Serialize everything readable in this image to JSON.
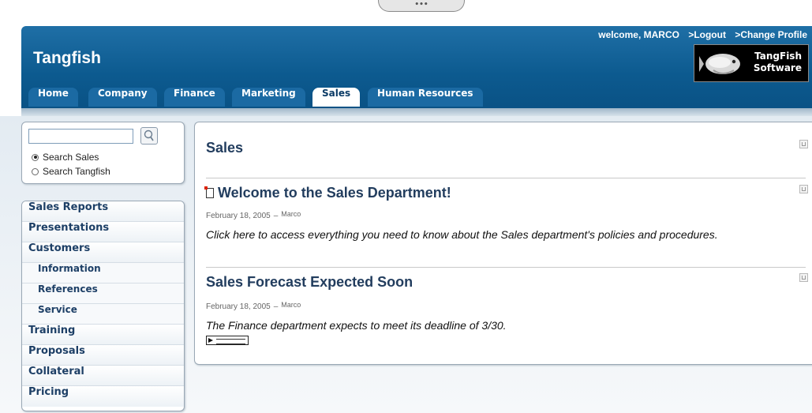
{
  "top_handle": "•••",
  "header": {
    "welcome": "welcome, MARCO",
    "logout": ">Logout",
    "change_profile": ">Change Profile",
    "site_title": "Tangfish",
    "logo_line1": "TangFish",
    "logo_line2": "Software",
    "bg_color": "#0c5a8f"
  },
  "tabs": [
    {
      "label": "Home"
    },
    {
      "label": "Company"
    },
    {
      "label": "Finance"
    },
    {
      "label": "Marketing"
    },
    {
      "label": "Sales",
      "active": true
    },
    {
      "label": "Human Resources"
    }
  ],
  "search": {
    "value": "",
    "option_sales": "Search Sales",
    "option_tangfish": "Search Tangfish",
    "selected": "Search Sales"
  },
  "sidenav": [
    {
      "label": "Sales Reports"
    },
    {
      "label": "Presentations"
    },
    {
      "label": "Customers"
    },
    {
      "label": "Information",
      "sub": true
    },
    {
      "label": "References",
      "sub": true
    },
    {
      "label": "Service",
      "sub": true
    },
    {
      "label": "Training"
    },
    {
      "label": "Proposals"
    },
    {
      "label": "Collateral"
    },
    {
      "label": "Pricing"
    }
  ],
  "main": {
    "title": "Sales",
    "posts": [
      {
        "title": "Welcome to the Sales Department!",
        "date": "February 18, 2005",
        "sep": "–",
        "author": "Marco",
        "body": "Click here to access everything you need to know about the Sales department's policies and procedures."
      },
      {
        "title": "Sales Forecast Expected Soon",
        "date": "February 18, 2005",
        "sep": "–",
        "author": "Marco",
        "body": "The Finance department expects to meet its deadline of 3/30."
      }
    ]
  }
}
